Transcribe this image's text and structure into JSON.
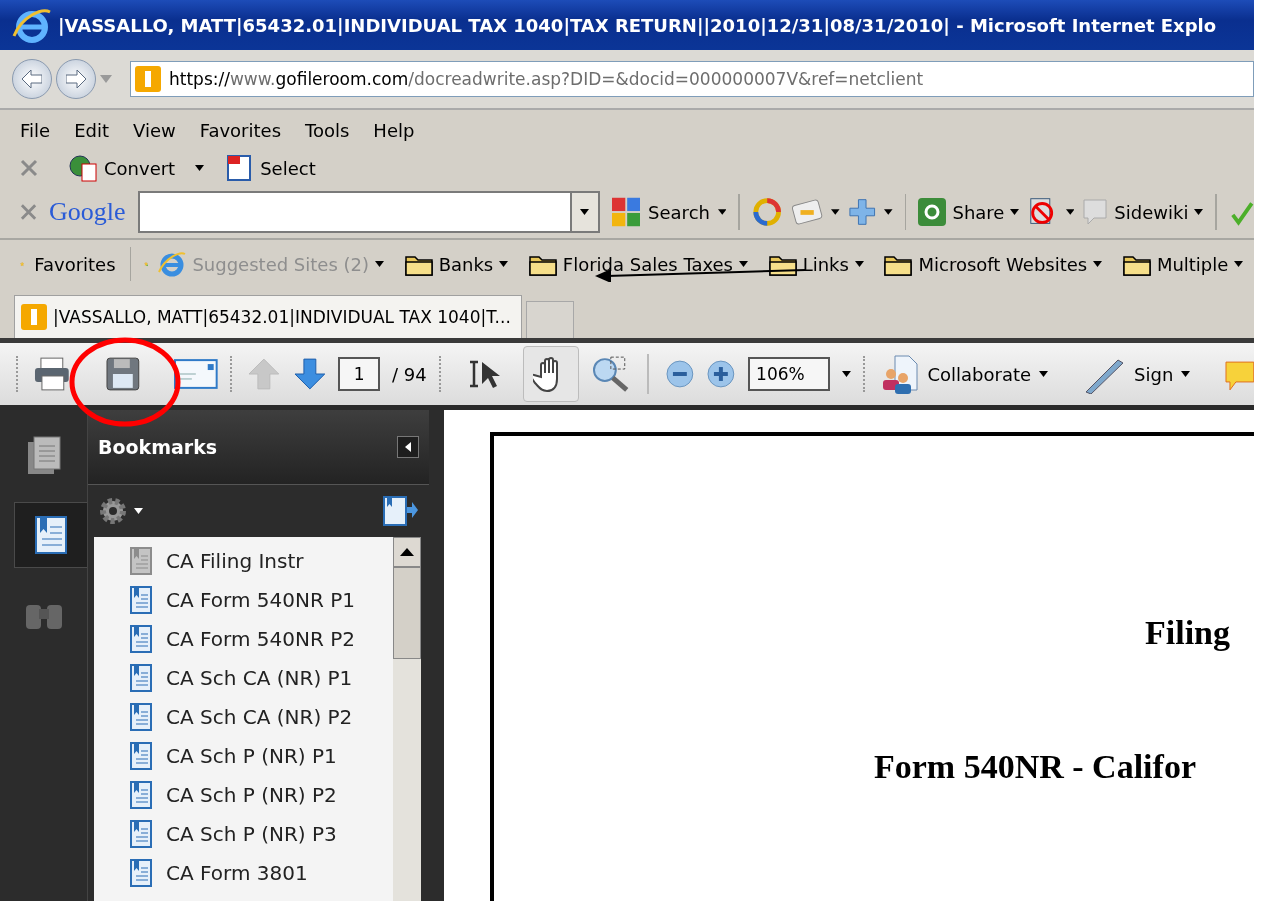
{
  "window": {
    "title": "|VASSALLO, MATT|65432.01|INDIVIDUAL TAX 1040|TAX RETURN||2010|12/31|08/31/2010| - Microsoft Internet Explo"
  },
  "address_bar": {
    "url_parts": [
      {
        "text": "https://",
        "dim": false
      },
      {
        "text": "www.",
        "dim": true
      },
      {
        "text": "gofileroom.com",
        "dim": false
      },
      {
        "text": "/docreadwrite.asp?DID=&docid=000000007V&ref=netclient",
        "dim": true
      }
    ]
  },
  "menu_bar": [
    "File",
    "Edit",
    "View",
    "Favorites",
    "Tools",
    "Help"
  ],
  "convert_toolbar": [
    {
      "label": "Convert",
      "menu": true,
      "kind": "convert"
    },
    {
      "label": "Select",
      "menu": false,
      "kind": "select"
    }
  ],
  "google_toolbar": {
    "logo": "Google",
    "search_label": "Search",
    "items": [
      {
        "label": "Share",
        "menu": true,
        "kind": "share"
      },
      {
        "label": "Sidewiki",
        "menu": true,
        "kind": "sidewiki"
      }
    ]
  },
  "favorites_bar": {
    "label": "Favorites",
    "links": [
      {
        "label": "Suggested Sites (2)",
        "disabled": true,
        "kind": "web"
      },
      {
        "label": "Banks",
        "disabled": false,
        "kind": "folder"
      },
      {
        "label": "Florida Sales Taxes",
        "disabled": false,
        "kind": "folder"
      },
      {
        "label": "Links",
        "disabled": false,
        "kind": "folder"
      },
      {
        "label": "Microsoft Websites",
        "disabled": false,
        "kind": "folder"
      },
      {
        "label": "Multiple",
        "disabled": false,
        "kind": "folder"
      }
    ]
  },
  "tabs": [
    {
      "label": "|VASSALLO, MATT|65432.01|INDIVIDUAL TAX 1040|T...",
      "selected": true
    }
  ],
  "pdf_toolbar": {
    "page": "1",
    "total": "/ 94",
    "zoom": "106%",
    "tools": [
      {
        "kind": "select",
        "selected": false
      },
      {
        "kind": "hand",
        "selected": true
      }
    ],
    "tasks": [
      {
        "label": "Collaborate",
        "kind": "collaborate"
      },
      {
        "label": "Sign",
        "kind": "sign"
      }
    ]
  },
  "bookmarks": {
    "title": "Bookmarks",
    "items": [
      {
        "label": "CA Filing Instr",
        "kind": "dim"
      },
      {
        "label": "CA Form 540NR P1",
        "kind": "normal"
      },
      {
        "label": "CA Form 540NR P2",
        "kind": "normal"
      },
      {
        "label": "CA Sch CA (NR) P1",
        "kind": "normal"
      },
      {
        "label": "CA Sch CA (NR) P2",
        "kind": "normal"
      },
      {
        "label": "CA Sch P (NR) P1",
        "kind": "normal"
      },
      {
        "label": "CA Sch P (NR) P2",
        "kind": "normal"
      },
      {
        "label": "CA Sch P (NR) P3",
        "kind": "normal"
      },
      {
        "label": "CA Form 3801",
        "kind": "normal"
      }
    ]
  },
  "document": {
    "lines": [
      {
        "text": "Filing",
        "kind": "heading"
      },
      {
        "text": "Form 540NR - Califor",
        "kind": "title"
      }
    ]
  }
}
